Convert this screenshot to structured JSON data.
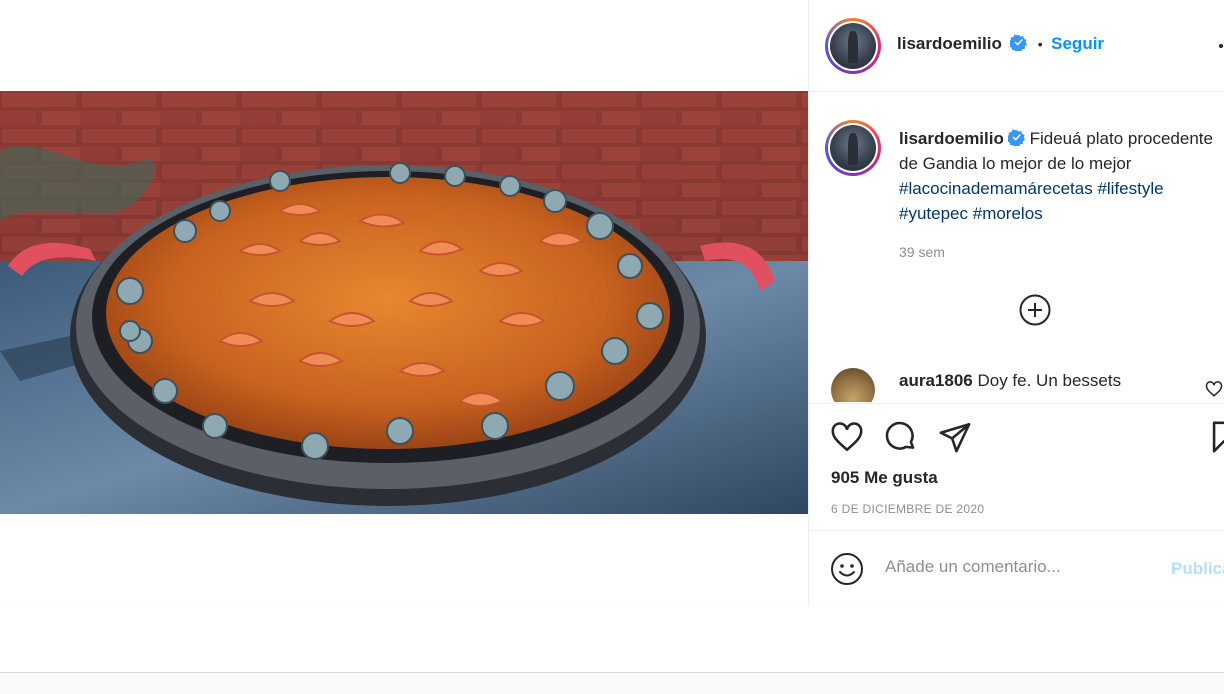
{
  "post": {
    "author": {
      "username": "lisardoemilio",
      "verified": true,
      "follow_label": "Seguir",
      "separator": "•"
    },
    "more_icon": "more-options-icon",
    "media": {
      "alt": "Fideuá en paellera"
    },
    "caption": {
      "username": "lisardoemilio",
      "text": "Fideuá plato procedente de Gandia lo mejor de lo mejor",
      "hashtags": [
        "#lacocinademamárecetas",
        "#lifestyle",
        "#yutepec",
        "#morelos"
      ],
      "time": "39 sem"
    },
    "comments": [
      {
        "username": "aura1806",
        "text": "Doy fe. Un bessets"
      }
    ],
    "likes": "905 Me gusta",
    "date": "6 DE DICIEMBRE DE 2020",
    "add_comment": {
      "placeholder": "Añade un comentario...",
      "publish_label": "Publicar"
    }
  },
  "colors": {
    "accent": "#0095f6",
    "publish_disabled": "#b2dffc",
    "hashtag": "#00376b",
    "muted": "#8e8e8e"
  }
}
